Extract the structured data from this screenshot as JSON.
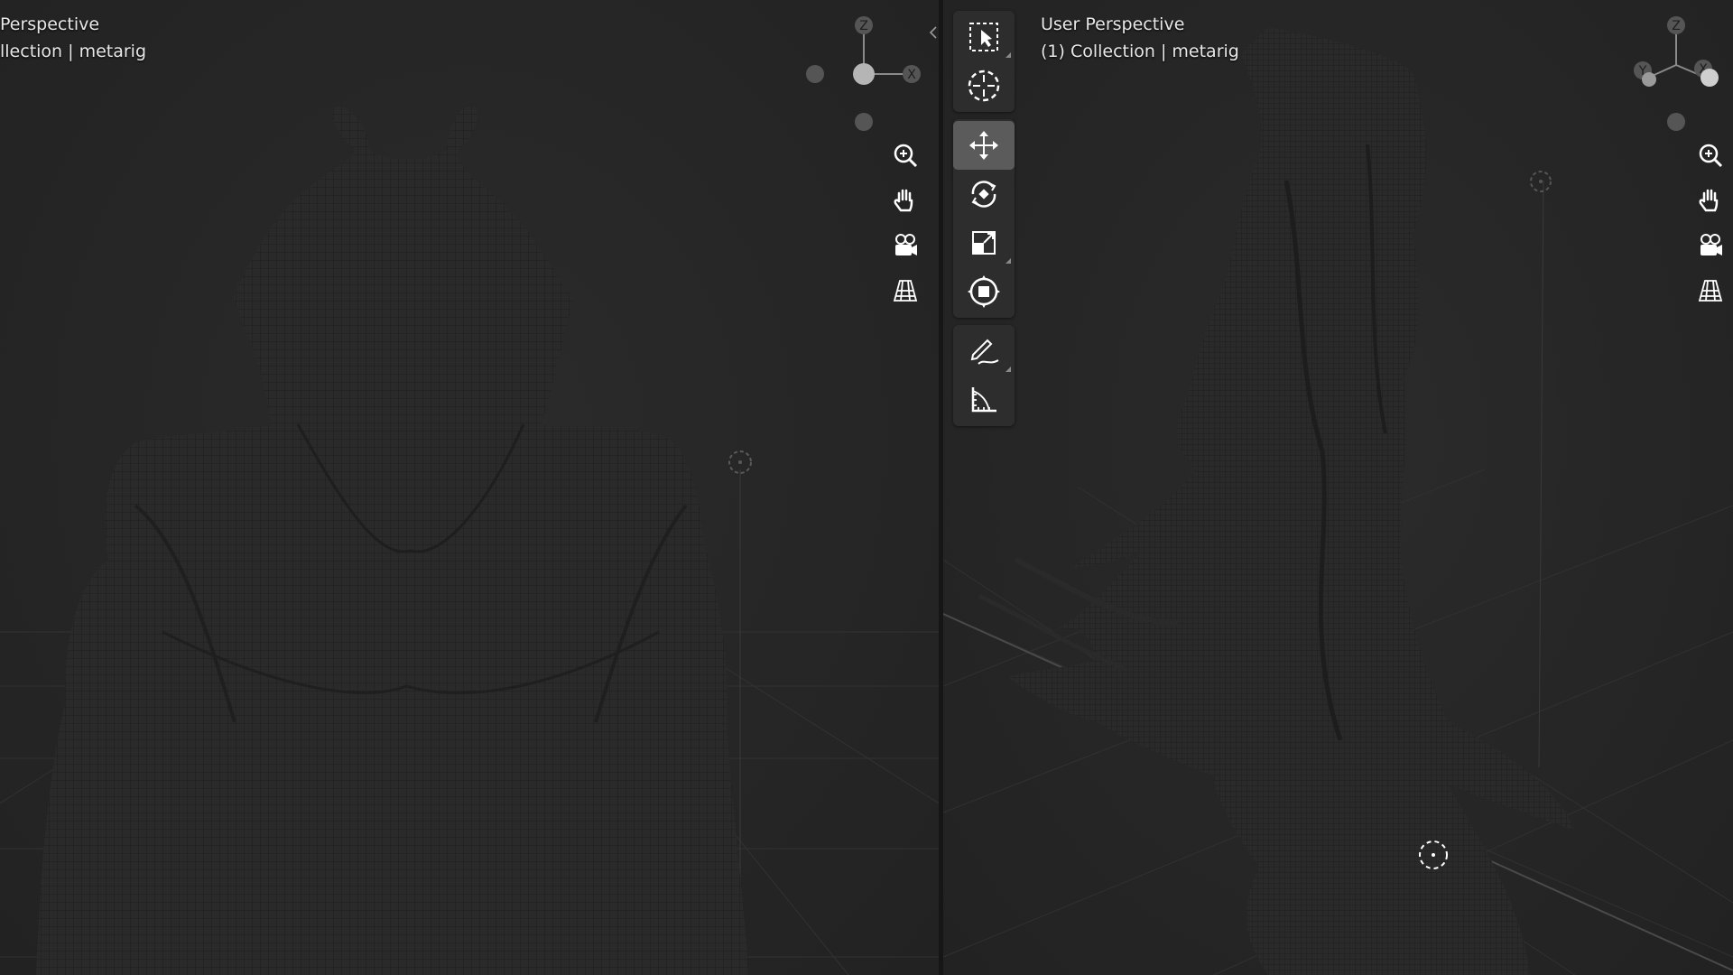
{
  "left_view": {
    "title": "Perspective",
    "subtitle": "llection | metarig",
    "gizmo": {
      "z_label": "Z",
      "x_label": "X"
    }
  },
  "right_view": {
    "title": "User Perspective",
    "subtitle": "(1) Collection | metarig",
    "gizmo": {
      "z_label": "Z",
      "y_label": "Y",
      "x_label": "X"
    }
  },
  "nav_tools": [
    "zoom-icon",
    "hand-pan-icon",
    "camera-icon",
    "grid-ortho-icon"
  ],
  "toolbar": {
    "tools": [
      "select-box-icon",
      "cursor-icon",
      "move-icon",
      "rotate-icon",
      "scale-icon",
      "transform-icon",
      "annotate-icon",
      "measure-icon"
    ],
    "active_tool": "move-icon"
  },
  "colors": {
    "viewport_bg": "#262626",
    "grid_line": "#343434",
    "mesh_fill": "#2a2a2a",
    "mesh_wire": "#1b1b1b",
    "toolbar_bg": "#2d2d2d",
    "active_tool_bg": "#5b5b5b"
  }
}
